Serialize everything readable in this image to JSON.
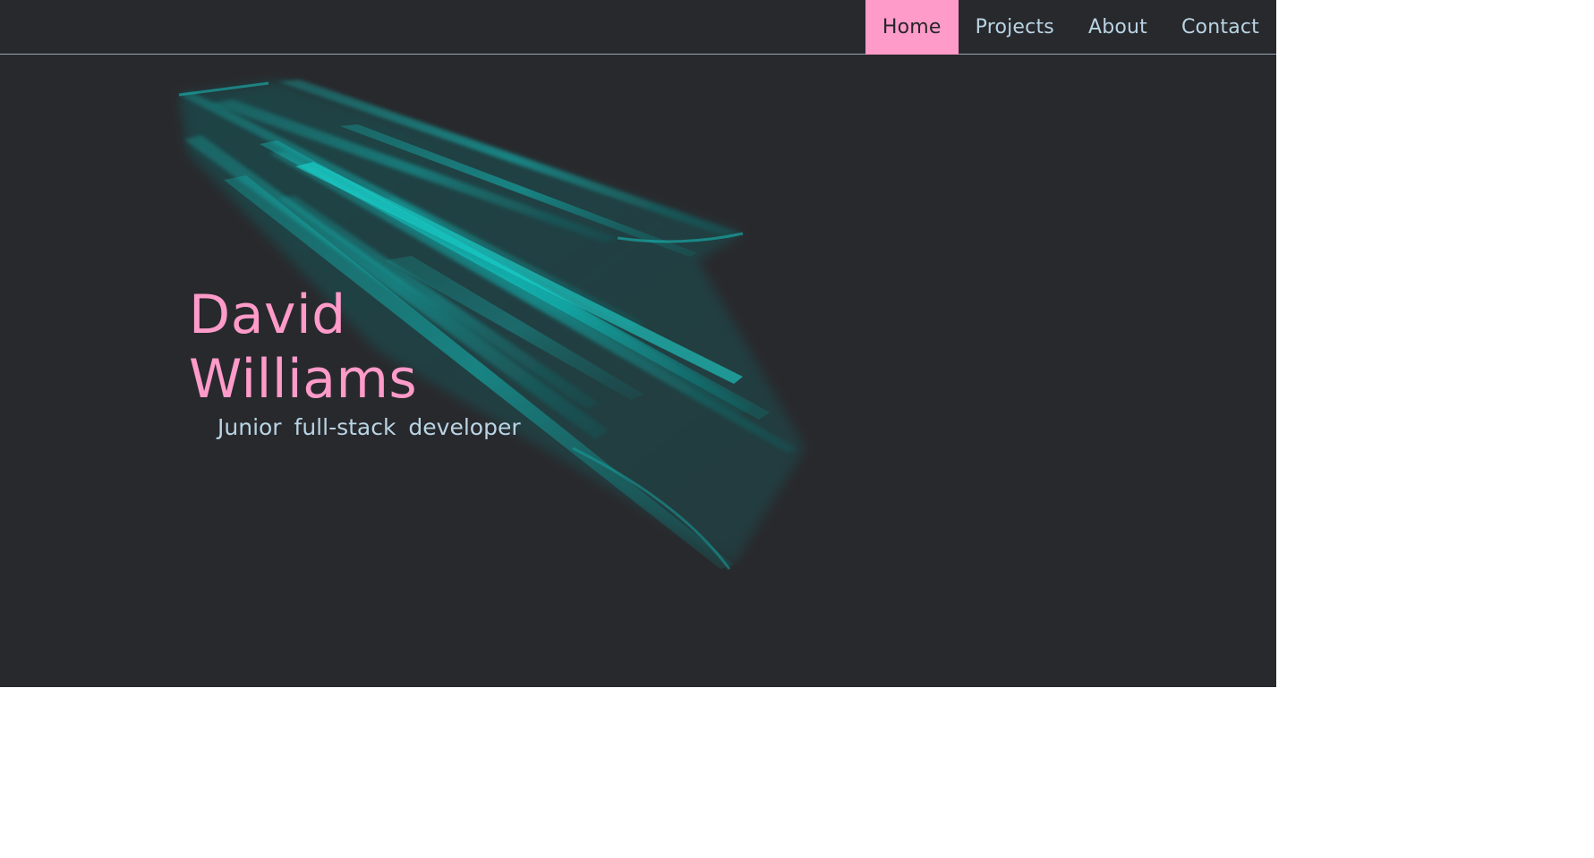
{
  "nav": {
    "items": [
      {
        "label": "Home",
        "active": true
      },
      {
        "label": "Projects",
        "active": false
      },
      {
        "label": "About",
        "active": false
      },
      {
        "label": "Contact",
        "active": false
      }
    ]
  },
  "hero": {
    "name": "David Williams",
    "role": "Junior full-stack developer"
  },
  "colors": {
    "background": "#28292d",
    "accent_pink": "#ff9bc9",
    "text_light": "#b9d4e4",
    "teal": "#10c4c0",
    "divider": "#8fa6b2"
  }
}
